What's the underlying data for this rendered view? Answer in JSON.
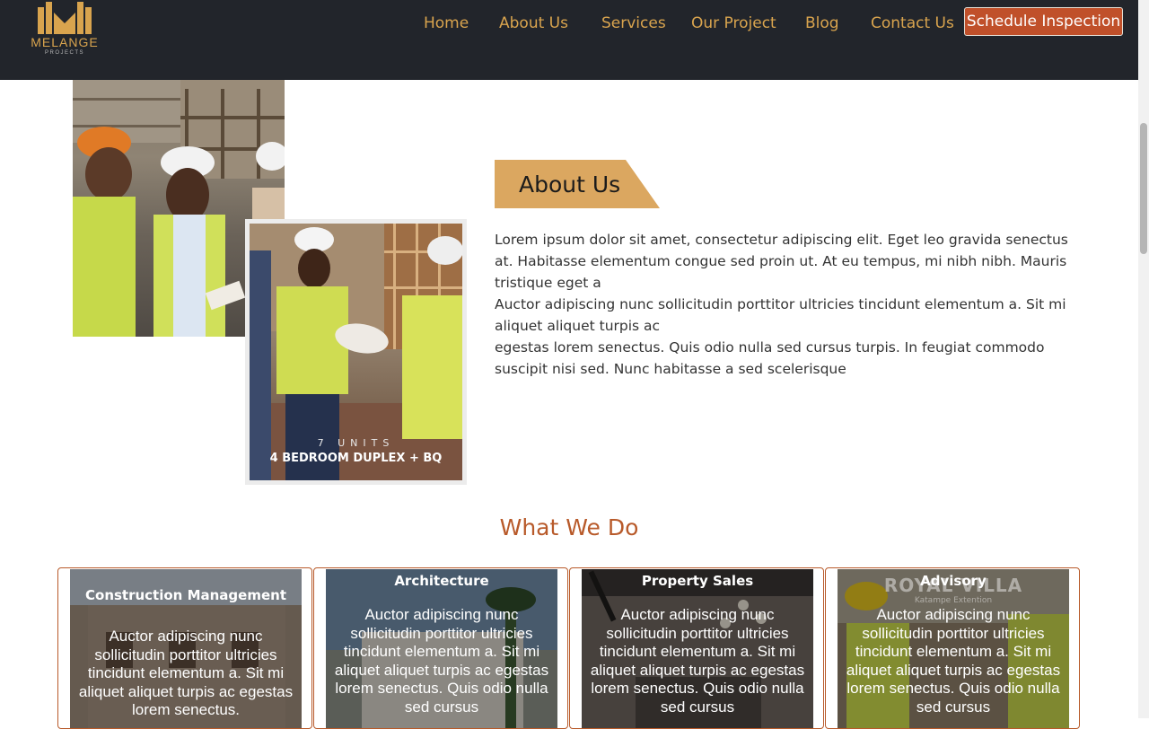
{
  "brand": {
    "name": "MELANGE",
    "sub": "PROJECTS",
    "accent": "#d9a44e",
    "header_bg": "#22252b"
  },
  "nav": {
    "items": [
      "Home",
      "About Us",
      "Services",
      "Our Project",
      "Blog",
      "Contact Us"
    ],
    "cta": "Schedule Inspection",
    "cta_color": "#c0502a"
  },
  "hero_photos": {
    "caption_units": "7 UNITS",
    "caption_main": "4 BEDROOM DUPLEX + BQ"
  },
  "about": {
    "title": "About Us",
    "banner_color": "#dba760",
    "paragraphs": [
      "Lorem ipsum dolor sit amet, consectetur adipiscing elit. Eget leo gravida senectus at. Habitasse elementum congue sed proin ut. At eu tempus, mi nibh nibh. Mauris tristique eget a",
      "Auctor adipiscing nunc sollicitudin porttitor ultricies tincidunt elementum a. Sit mi aliquet aliquet turpis ac",
      "egestas lorem senectus. Quis odio nulla sed cursus turpis. In feugiat commodo suscipit nisi sed. Nunc habitasse a sed scelerisque"
    ]
  },
  "services": {
    "title": "What We Do",
    "title_color": "#b85a2a",
    "cards": [
      {
        "title": "Construction Management",
        "text": "Auctor adipiscing nunc sollicitudin porttitor ultricies tincidunt elementum a. Sit mi aliquet aliquet turpis ac egestas lorem senectus."
      },
      {
        "title": "Architecture",
        "text": "Auctor adipiscing nunc sollicitudin porttitor ultricies tincidunt elementum a. Sit mi aliquet aliquet turpis ac egestas lorem senectus. Quis odio nulla sed cursus"
      },
      {
        "title": "Property Sales",
        "text": "Auctor adipiscing nunc sollicitudin porttitor ultricies tincidunt elementum a. Sit mi aliquet aliquet turpis ac egestas lorem senectus. Quis odio nulla sed cursus"
      },
      {
        "title": "Advisory",
        "text": "Auctor adipiscing nunc sollicitudin porttitor ultricies tincidunt elementum a. Sit mi aliquet aliquet turpis ac egestas lorem senectus. Quis odio nulla sed cursus",
        "watermark": "ROYAL VILLA",
        "watermark_sub": "Katampe Extention"
      }
    ]
  }
}
